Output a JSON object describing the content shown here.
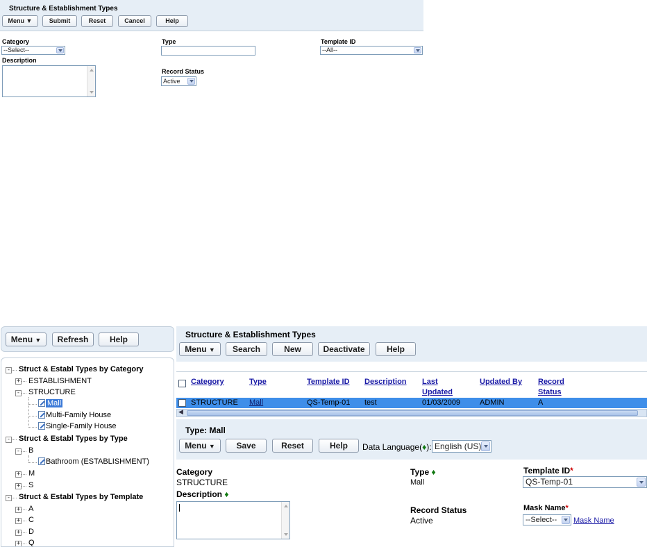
{
  "top": {
    "title": "Structure & Establishment Types",
    "toolbar": {
      "menu": "Menu",
      "submit": "Submit",
      "reset": "Reset",
      "cancel": "Cancel",
      "help": "Help"
    },
    "fields": {
      "category_label": "Category",
      "category_value": "--Select--",
      "type_label": "Type",
      "type_value": "",
      "template_label": "Template ID",
      "template_value": "--All--",
      "description_label": "Description",
      "record_status_label": "Record Status",
      "record_status_value": "Active"
    }
  },
  "left": {
    "toolbar": {
      "menu": "Menu",
      "refresh": "Refresh",
      "help": "Help"
    },
    "tree": {
      "by_category": "Struct & Establ Types by Category",
      "establishment": "ESTABLISHMENT",
      "structure": "STRUCTURE",
      "mall": "Mall",
      "multi_family": "Multi-Family House",
      "single_family": "Single-Family House",
      "by_type": "Struct & Establ Types by Type",
      "type_b": "B",
      "bathroom": "Bathroom (ESTABLISHMENT)",
      "type_m": "M",
      "type_s": "S",
      "by_template": "Struct & Establ Types by Template",
      "tpl_a": "A",
      "tpl_c": "C",
      "tpl_d": "D",
      "tpl_q": "Q"
    }
  },
  "right": {
    "title": "Structure & Establishment Types",
    "toolbar": {
      "menu": "Menu",
      "search": "Search",
      "new": "New",
      "deactivate": "Deactivate",
      "help": "Help"
    },
    "grid": {
      "headers": {
        "category": "Category",
        "type": "Type",
        "template_id": "Template ID",
        "description": "Description",
        "last_updated": "Last Updated",
        "updated_by": "Updated By",
        "record_status": "Record Status"
      },
      "row": {
        "category": "STRUCTURE",
        "type": "Mall",
        "template_id": "QS-Temp-01",
        "description": "test",
        "last_updated": "01/03/2009",
        "updated_by": "ADMIN",
        "record_status": "A"
      }
    },
    "detail": {
      "title": "Type: Mall",
      "toolbar": {
        "menu": "Menu",
        "save": "Save",
        "reset": "Reset",
        "help": "Help"
      },
      "data_language_label": "Data Language(",
      "data_language_mark": "♦",
      "data_language_suffix": "):",
      "data_language_value": "English (US)",
      "category_label": "Category",
      "category_value": "STRUCTURE",
      "type_label": "Type",
      "type_value": "Mall",
      "template_label": "Template ID",
      "template_value": "QS-Temp-01",
      "description_label": "Description",
      "record_status_label": "Record Status",
      "record_status_value": "Active",
      "mask_label": "Mask Name",
      "mask_value": "--Select--",
      "mask_link": "Mask Name",
      "required_mark": "*",
      "translatable_mark": "♦"
    }
  },
  "colors": {
    "header_bg": "#e6eef6",
    "selected_row": "#3e8ee9",
    "link": "#1a1aa6",
    "required": "#cc0000",
    "translatable": "#137a13"
  }
}
